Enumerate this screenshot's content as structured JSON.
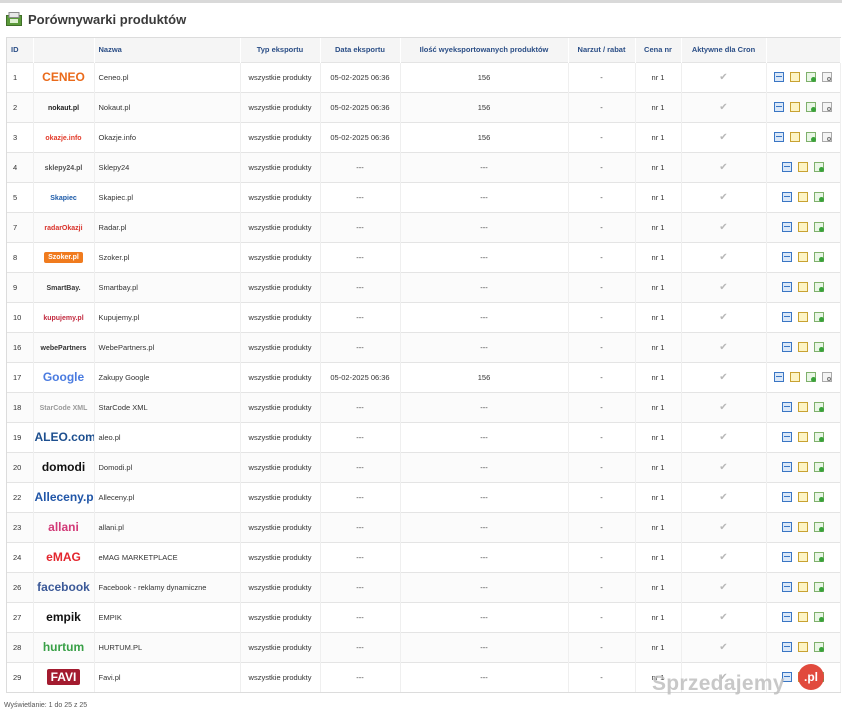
{
  "page": {
    "title": "Porównywarki produktów"
  },
  "columns": [
    "ID",
    "Nazwa",
    "Typ eksportu",
    "Data eksportu",
    "Ilość wyeksportowanych produktów",
    "Narzut / rabat",
    "Cena nr",
    "Aktywne dla Cron"
  ],
  "rows": [
    {
      "id": "1",
      "logo": "CENEO",
      "logo_color": "#ea6a1a",
      "name": "Ceneo.pl",
      "type": "wszystkie produkty",
      "date": "05-02-2025 06:36",
      "count": "156",
      "markup": "-",
      "price": "nr 1",
      "actions": 4
    },
    {
      "id": "2",
      "logo": "nokaut.pl",
      "logo_color": "#222222",
      "name": "Nokaut.pl",
      "type": "wszystkie produkty",
      "date": "05-02-2025 06:36",
      "count": "156",
      "markup": "-",
      "price": "nr 1",
      "actions": 4
    },
    {
      "id": "3",
      "logo": "okazje.info",
      "logo_color": "#e23b2a",
      "name": "Okazje.info",
      "type": "wszystkie produkty",
      "date": "05-02-2025 06:36",
      "count": "156",
      "markup": "-",
      "price": "nr 1",
      "actions": 4
    },
    {
      "id": "4",
      "logo": "sklepy24.pl",
      "logo_color": "#555555",
      "name": "Sklepy24",
      "type": "wszystkie produkty",
      "date": "---",
      "count": "---",
      "markup": "-",
      "price": "nr 1",
      "actions": 3
    },
    {
      "id": "5",
      "logo": "Skapiec",
      "logo_color": "#1c5aa8",
      "name": "Skapiec.pl",
      "type": "wszystkie produkty",
      "date": "---",
      "count": "---",
      "markup": "-",
      "price": "nr 1",
      "actions": 3
    },
    {
      "id": "7",
      "logo": "radarOkazji",
      "logo_color": "#d8312a",
      "name": "Radar.pl",
      "type": "wszystkie produkty",
      "date": "---",
      "count": "---",
      "markup": "-",
      "price": "nr 1",
      "actions": 3
    },
    {
      "id": "8",
      "logo": "Szoker.pl",
      "logo_color": "#f07b1e",
      "name": "Szoker.pl",
      "type": "wszystkie produkty",
      "date": "---",
      "count": "---",
      "markup": "-",
      "price": "nr 1",
      "actions": 3
    },
    {
      "id": "9",
      "logo": "SmartBay.",
      "logo_color": "#3a3a3a",
      "name": "Smartbay.pl",
      "type": "wszystkie produkty",
      "date": "---",
      "count": "---",
      "markup": "-",
      "price": "nr 1",
      "actions": 3
    },
    {
      "id": "10",
      "logo": "kupujemy.pl",
      "logo_color": "#c22a3f",
      "name": "Kupujemy.pl",
      "type": "wszystkie produkty",
      "date": "---",
      "count": "---",
      "markup": "-",
      "price": "nr 1",
      "actions": 3
    },
    {
      "id": "16",
      "logo": "webePartners",
      "logo_color": "#333333",
      "name": "WebePartners.pl",
      "type": "wszystkie produkty",
      "date": "---",
      "count": "---",
      "markup": "-",
      "price": "nr 1",
      "actions": 3
    },
    {
      "id": "17",
      "logo": "Google",
      "logo_color": "#4a7be0",
      "name": "Zakupy Google",
      "type": "wszystkie produkty",
      "date": "05-02-2025 06:36",
      "count": "156",
      "markup": "-",
      "price": "nr 1",
      "actions": 4
    },
    {
      "id": "18",
      "logo": "StarCode XML",
      "logo_color": "#9a9a9a",
      "name": "StarCode XML",
      "type": "wszystkie produkty",
      "date": "---",
      "count": "---",
      "markup": "-",
      "price": "nr 1",
      "actions": 3
    },
    {
      "id": "19",
      "logo": "ALEO.com",
      "logo_color": "#1d4f8f",
      "name": "aleo.pl",
      "type": "wszystkie produkty",
      "date": "---",
      "count": "---",
      "markup": "-",
      "price": "nr 1",
      "actions": 3
    },
    {
      "id": "20",
      "logo": "domodi",
      "logo_color": "#111111",
      "name": "Domodi.pl",
      "type": "wszystkie produkty",
      "date": "---",
      "count": "---",
      "markup": "-",
      "price": "nr 1",
      "actions": 3
    },
    {
      "id": "22",
      "logo": "Alleceny.pl",
      "logo_color": "#2156a8",
      "name": "Alleceny.pl",
      "type": "wszystkie produkty",
      "date": "---",
      "count": "---",
      "markup": "-",
      "price": "nr 1",
      "actions": 3
    },
    {
      "id": "23",
      "logo": "allani",
      "logo_color": "#d23a78",
      "name": "allani.pl",
      "type": "wszystkie produkty",
      "date": "---",
      "count": "---",
      "markup": "-",
      "price": "nr 1",
      "actions": 3
    },
    {
      "id": "24",
      "logo": "eMAG",
      "logo_color": "#e3262e",
      "name": "eMAG MARKETPLACE",
      "type": "wszystkie produkty",
      "date": "---",
      "count": "---",
      "markup": "-",
      "price": "nr 1",
      "actions": 3
    },
    {
      "id": "26",
      "logo": "facebook",
      "logo_color": "#3b5998",
      "name": "Facebook - reklamy dynamiczne",
      "type": "wszystkie produkty",
      "date": "---",
      "count": "---",
      "markup": "-",
      "price": "nr 1",
      "actions": 3
    },
    {
      "id": "27",
      "logo": "empik",
      "logo_color": "#111111",
      "name": "EMPIK",
      "type": "wszystkie produkty",
      "date": "---",
      "count": "---",
      "markup": "-",
      "price": "nr 1",
      "actions": 3
    },
    {
      "id": "28",
      "logo": "hurtum",
      "logo_color": "#39a047",
      "name": "HURTUM.PL",
      "type": "wszystkie produkty",
      "date": "---",
      "count": "---",
      "markup": "-",
      "price": "nr 1",
      "actions": 3
    },
    {
      "id": "29",
      "logo": "FAVI",
      "logo_color": "#a31b2f",
      "name": "Favi.pl",
      "type": "wszystkie produkty",
      "date": "---",
      "count": "---",
      "markup": "-",
      "price": "nr 1",
      "actions": 3
    }
  ],
  "footer": {
    "text": "Wyświetlanie: 1 do 25 z 25"
  },
  "watermark": {
    "text": "Sprzedajemy",
    "badge": ".pl"
  },
  "colors": {
    "header_text": "#2b4e86",
    "accent_red": "#e14a3d"
  },
  "icons": {
    "header": "module-icon",
    "check": "checkmark-icon",
    "preview": "preview-icon",
    "edit": "edit-icon",
    "export": "export-icon",
    "search": "search-icon"
  }
}
